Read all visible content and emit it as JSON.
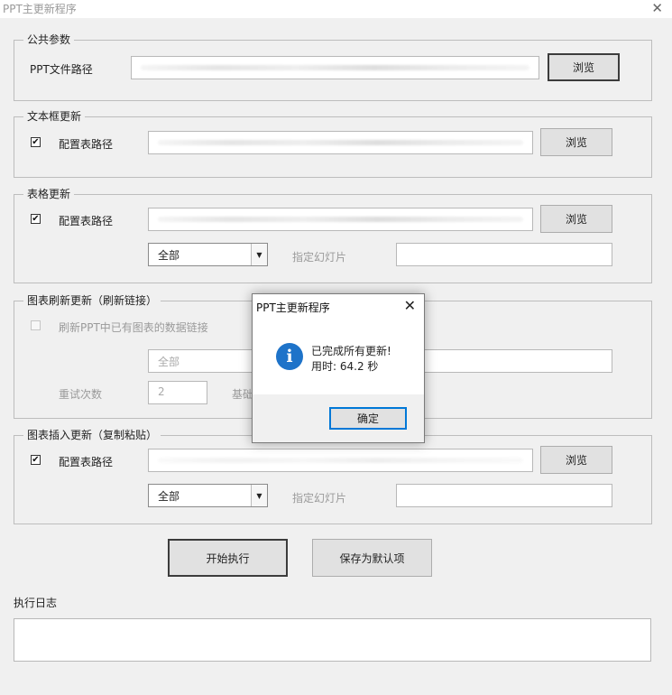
{
  "window": {
    "title": "PPT主更新程序",
    "close_glyph": "✕"
  },
  "common": {
    "legend": "公共参数",
    "path_label": "PPT文件路径",
    "browse": "浏览"
  },
  "textbox_update": {
    "legend": "文本框更新",
    "check": "✔",
    "path_label": "配置表路径",
    "browse": "浏览"
  },
  "table_update": {
    "legend": "表格更新",
    "check": "✔",
    "path_label": "配置表路径",
    "browse": "浏览",
    "scope_value": "全部",
    "slide_label": "指定幻灯片"
  },
  "chart_refresh": {
    "legend": "图表刷新更新（刷新链接）",
    "refresh_label": "刷新PPT中已有图表的数据链接",
    "scope_value": "全部",
    "retry_label": "重试次数",
    "retry_value": "2",
    "base_label": "基础"
  },
  "chart_insert": {
    "legend": "图表插入更新（复制粘贴）",
    "check": "✔",
    "path_label": "配置表路径",
    "browse": "浏览",
    "scope_value": "全部",
    "slide_label": "指定幻灯片"
  },
  "actions": {
    "start": "开始执行",
    "save_default": "保存为默认项"
  },
  "log": {
    "label": "执行日志"
  },
  "dialog": {
    "title": "PPT主更新程序",
    "close_glyph": "✕",
    "icon_glyph": "i",
    "message": "已完成所有更新!",
    "elapsed": "用时: 64.2 秒",
    "ok": "确定"
  },
  "colors": {
    "info_icon": "#1e73c9",
    "focus": "#0078d7"
  }
}
